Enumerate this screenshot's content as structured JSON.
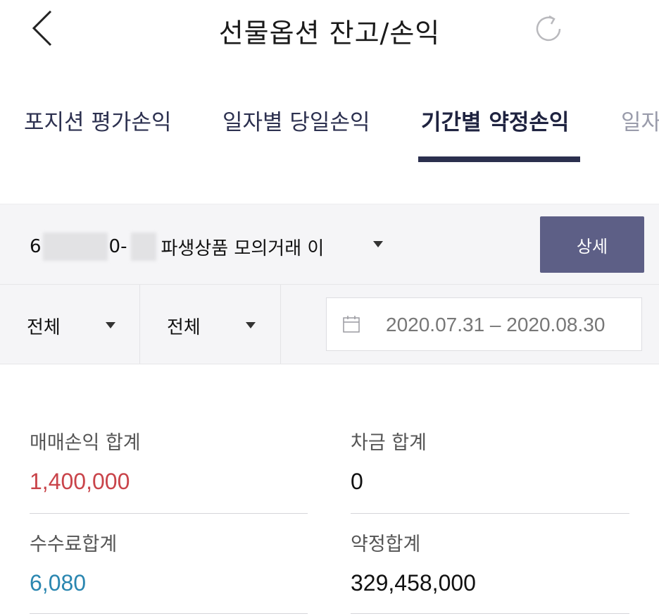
{
  "header": {
    "title": "선물옵션 잔고/손익",
    "back_icon": "chevron-left-icon",
    "refresh_icon": "refresh-icon"
  },
  "tabs": [
    {
      "label": "포지션 평가손익",
      "active": false
    },
    {
      "label": "일자별 당일손익",
      "active": false
    },
    {
      "label": "기간별 약정손익",
      "active": true
    },
    {
      "label": "일자",
      "active": false
    }
  ],
  "account": {
    "prefix": "6",
    "middle": "0-",
    "name": "파생상품 모의거래 이",
    "detail_button": "상세"
  },
  "filters": {
    "filter1": "전체",
    "filter2": "전체",
    "date_range": "2020.07.31 – 2020.08.30"
  },
  "summary": {
    "trade_pnl_label": "매매손익 합계",
    "trade_pnl_value": "1,400,000",
    "diff_label": "차금 합계",
    "diff_value": "0",
    "fee_label": "수수료합계",
    "fee_value": "6,080",
    "contract_label": "약정합계",
    "contract_value": "329,458,000"
  },
  "colors": {
    "accent_navy": "#2b2f4e",
    "button_bg": "#5d5f86",
    "profit_red": "#c9444a",
    "fee_blue": "#2a86b0"
  }
}
